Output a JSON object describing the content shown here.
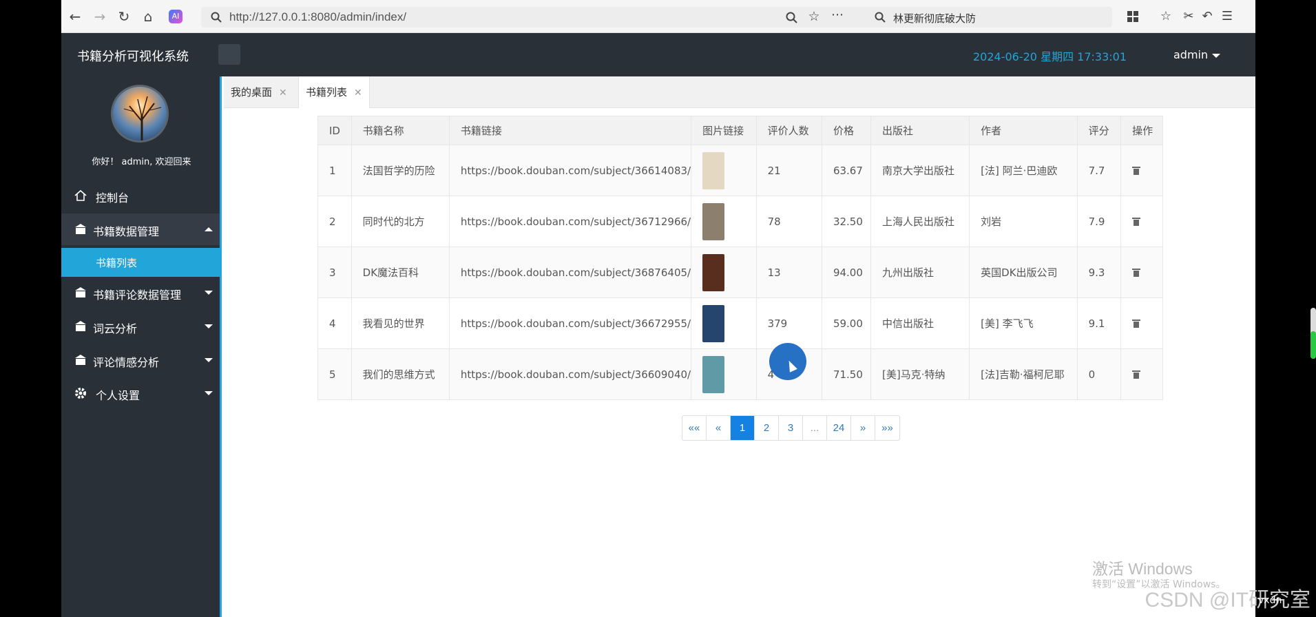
{
  "browser": {
    "url": "http://127.0.0.1:8080/admin/index/",
    "search_text": "林更新彻底破大防",
    "ai_label": "AI"
  },
  "header": {
    "title": "书籍分析可视化系统",
    "datetime": "2024-06-20  星期四  17:33:01",
    "user": "admin"
  },
  "sidebar": {
    "greeting": "你好！ admin, 欢迎回来",
    "items": [
      {
        "label": "控制台",
        "icon": "home-icon"
      },
      {
        "label": "书籍数据管理",
        "icon": "bank-icon",
        "expanded": true
      },
      {
        "label": "书籍列表",
        "active": true
      },
      {
        "label": "书籍评论数据管理",
        "icon": "bank-icon"
      },
      {
        "label": "词云分析",
        "icon": "bank-icon"
      },
      {
        "label": "评论情感分析",
        "icon": "bank-icon"
      },
      {
        "label": "个人设置",
        "icon": "gear-icon"
      }
    ]
  },
  "tabs": [
    {
      "label": "我的桌面"
    },
    {
      "label": "书籍列表",
      "active": true
    }
  ],
  "table": {
    "headers": [
      "ID",
      "书籍名称",
      "书籍链接",
      "图片链接",
      "评价人数",
      "价格",
      "出版社",
      "作者",
      "评分",
      "操作"
    ],
    "rows": [
      {
        "id": "1",
        "name": "法国哲学的历险",
        "link": "https://book.douban.com/subject/36614083/",
        "reviews": "21",
        "price": "63.67",
        "publisher": "南京大学出版社",
        "author": "[法] 阿兰·巴迪欧",
        "rating": "7.7",
        "cover_color": "#e4d8c2"
      },
      {
        "id": "2",
        "name": "同时代的北方",
        "link": "https://book.douban.com/subject/36712966/",
        "reviews": "78",
        "price": "32.50",
        "publisher": "上海人民出版社",
        "author": "刘岩",
        "rating": "7.9",
        "cover_color": "#8c7f6e"
      },
      {
        "id": "3",
        "name": "DK魔法百科",
        "link": "https://book.douban.com/subject/36876405/",
        "reviews": "13",
        "price": "94.00",
        "publisher": "九州出版社",
        "author": "英国DK出版公司",
        "rating": "9.3",
        "cover_color": "#5a2e1e"
      },
      {
        "id": "4",
        "name": "我看见的世界",
        "link": "https://book.douban.com/subject/36672955/",
        "reviews": "379",
        "price": "59.00",
        "publisher": "中信出版社",
        "author": "[美] 李飞飞",
        "rating": "9.1",
        "cover_color": "#25446e"
      },
      {
        "id": "5",
        "name": "我们的思维方式",
        "link": "https://book.douban.com/subject/36609040/",
        "reviews": "4",
        "price": "71.50",
        "publisher": "[美]马克·特纳",
        "author": "[法]吉勒·福柯尼耶",
        "rating": "0",
        "cover_color": "#5f9aa6"
      }
    ]
  },
  "pagination": {
    "first": "««",
    "prev": "«",
    "pages": [
      "1",
      "2",
      "3",
      "...",
      "24"
    ],
    "current": "1",
    "next": "»",
    "last": "»»"
  },
  "watermark": {
    "line1": "激活 Windows",
    "line2": "转到“设置”以激活 Windows。",
    "csdn": "CSDN @IT研究室",
    "corner": "vxdn"
  }
}
